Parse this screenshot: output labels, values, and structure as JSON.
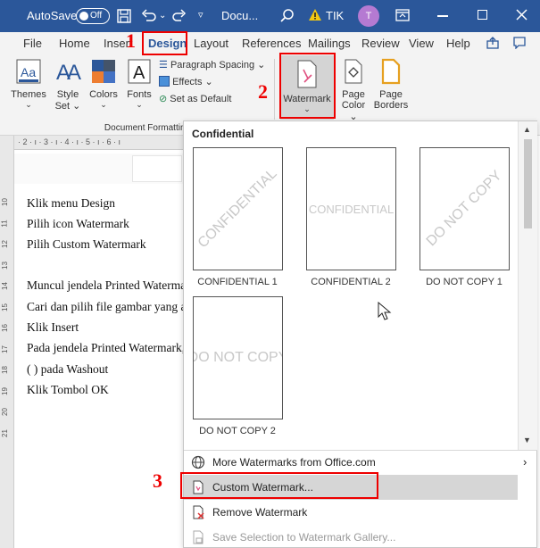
{
  "titlebar": {
    "autosave": "AutoSave",
    "autosave_state": "Off",
    "doc_name": "Docu...",
    "user_initials": "TIK",
    "avatar": "T"
  },
  "menubar": {
    "items": [
      "File",
      "Home",
      "Insert",
      "Design",
      "Layout",
      "References",
      "Mailings",
      "Review",
      "View",
      "Help"
    ]
  },
  "ribbon": {
    "themes": "Themes",
    "style_set_1": "Style",
    "style_set_2": "Set",
    "colors": "Colors",
    "fonts": "Fonts",
    "paragraph_spacing": "Paragraph Spacing",
    "effects": "Effects",
    "set_default": "Set as Default",
    "group_label": "Document Formatting",
    "watermark": "Watermark",
    "page_color_1": "Page",
    "page_color_2": "Color",
    "page_borders_1": "Page",
    "page_borders_2": "Borders"
  },
  "ruler": {
    "h": "· 2 · ı · 3 · ı · 4 · ı · 5 · ı · 6 · ı",
    "v": [
      "10",
      "11",
      "12",
      "13",
      "14",
      "15",
      "16",
      "17",
      "18",
      "19",
      "20",
      "21"
    ]
  },
  "document": {
    "lines": [
      "Klik menu Design",
      "Pilih icon Watermark",
      "Pilih Custom Watermark",
      "",
      "Muncul jendela Printed Waterma",
      "Cari dan pilih file gambar yang a",
      "Klik Insert",
      "Pada jendela Printed Watermark,",
      "( ) pada Washout",
      "Klik Tombol OK"
    ]
  },
  "dropdown": {
    "header": "Confidential",
    "watermarks": [
      {
        "text": "CONFIDENTIAL",
        "caption": "CONFIDENTIAL 1",
        "diagonal": true
      },
      {
        "text": "CONFIDENTIAL",
        "caption": "CONFIDENTIAL 2",
        "diagonal": false
      },
      {
        "text": "DO NOT COPY",
        "caption": "DO NOT COPY 1",
        "diagonal": true
      },
      {
        "text": "DO NOT COPY",
        "caption": "DO NOT COPY 2",
        "diagonal": false
      }
    ],
    "more": "More Watermarks from Office.com",
    "custom": "Custom Watermark...",
    "remove": "Remove Watermark",
    "save_selection": "Save Selection to Watermark Gallery..."
  },
  "annotations": {
    "n1": "1",
    "n2": "2",
    "n3": "3"
  },
  "colors": {
    "title_bar": "#2b579a",
    "annotation": "#ee0000",
    "highlight": "#d6d6d6"
  }
}
